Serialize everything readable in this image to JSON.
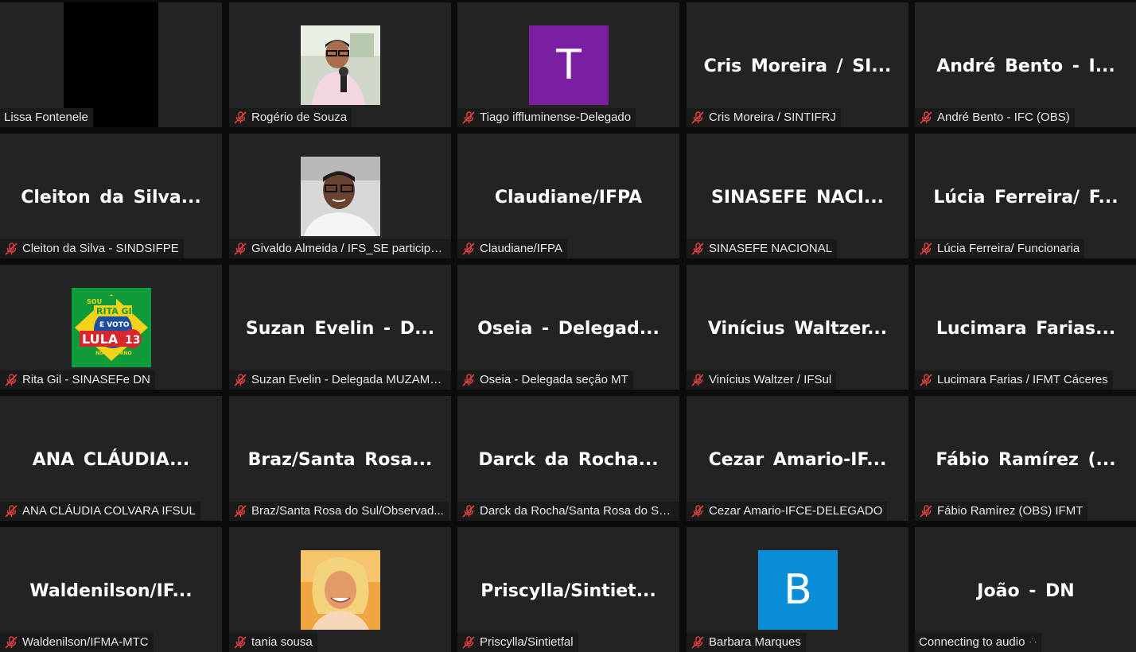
{
  "participants": [
    {
      "display_name": "",
      "label": "Lissa Fontenele",
      "muted": false,
      "type": "video-dark"
    },
    {
      "display_name": "",
      "label": "Rogério de Souza",
      "muted": true,
      "type": "photo",
      "photo": "man-microphone"
    },
    {
      "display_name": "T",
      "label": "Tiago iffluminense-Delegado",
      "muted": true,
      "type": "letter",
      "color": "#7a1fa2"
    },
    {
      "display_name": "Cris Moreira / SI...",
      "label": "Cris Moreira / SINTIFRJ",
      "muted": true,
      "type": "name"
    },
    {
      "display_name": "André Bento - I...",
      "label": "André Bento - IFC (OBS)",
      "muted": true,
      "type": "name"
    },
    {
      "display_name": "Cleiton da Silva...",
      "label": "Cleiton da Silva - SINDSIFPE",
      "muted": true,
      "type": "name"
    },
    {
      "display_name": "",
      "label": "Givaldo Almeida / IFS_SE participa...",
      "muted": true,
      "type": "photo",
      "photo": "man-glasses"
    },
    {
      "display_name": "Claudiane/IFPA",
      "label": "Claudiane/IFPA",
      "muted": true,
      "type": "name"
    },
    {
      "display_name": "SINASEFE NACI...",
      "label": "SINASEFE NACIONAL",
      "muted": true,
      "type": "name"
    },
    {
      "display_name": "Lúcia Ferreira/ F...",
      "label": "Lúcia Ferreira/ Funcionaria",
      "muted": true,
      "type": "name"
    },
    {
      "display_name": "",
      "label": "Rita Gil - SINASEFe DN",
      "muted": true,
      "type": "photo",
      "photo": "campaign-graphic",
      "graphic_text": [
        "SOU",
        "RITA GIL",
        "E VOTO",
        "LULA",
        "13",
        "NO 1º TURNO"
      ]
    },
    {
      "display_name": "Suzan Evelin - D...",
      "label": "Suzan Evelin - Delegada MUZAMB...",
      "muted": true,
      "type": "name"
    },
    {
      "display_name": "Oseia - Delegad...",
      "label": "Oseia - Delegada seção MT",
      "muted": true,
      "type": "name"
    },
    {
      "display_name": "Vinícius Waltzer...",
      "label": "Vinícius Waltzer / IFSul",
      "muted": true,
      "type": "name"
    },
    {
      "display_name": "Lucimara Farias...",
      "label": "Lucimara Farias / IFMT Cáceres",
      "muted": true,
      "type": "name"
    },
    {
      "display_name": "ANA CLÁUDIA...",
      "label": "ANA CLÁUDIA  COLVARA IFSUL",
      "muted": true,
      "type": "name"
    },
    {
      "display_name": "Braz/Santa Rosa...",
      "label": "Braz/Santa Rosa do Sul/Observad...",
      "muted": true,
      "type": "name"
    },
    {
      "display_name": "Darck da Rocha...",
      "label": "Darck da Rocha/Santa Rosa do Sul...",
      "muted": true,
      "type": "name"
    },
    {
      "display_name": "Cezar Amario-IF...",
      "label": "Cezar Amario-IFCE-DELEGADO",
      "muted": true,
      "type": "name"
    },
    {
      "display_name": "Fábio Ramírez (...",
      "label": "Fábio Ramírez (OBS) IFMT",
      "muted": true,
      "type": "name"
    },
    {
      "display_name": "Waldenilson/IF...",
      "label": "Waldenilson/IFMA-MTC",
      "muted": true,
      "type": "name"
    },
    {
      "display_name": "",
      "label": "tania sousa",
      "muted": true,
      "type": "photo",
      "photo": "woman-smiling"
    },
    {
      "display_name": "Priscylla/Sintiet...",
      "label": "Priscylla/Sintietfal",
      "muted": true,
      "type": "name"
    },
    {
      "display_name": "B",
      "label": "Barbara Marques",
      "muted": true,
      "type": "letter",
      "color": "#0a8ed8"
    },
    {
      "display_name": "João - DN",
      "label": "Connecting to audio",
      "muted": false,
      "type": "name",
      "connecting": true
    }
  ],
  "colors": {
    "tile_bg": "#232323",
    "mute_icon": "#e0403f"
  }
}
